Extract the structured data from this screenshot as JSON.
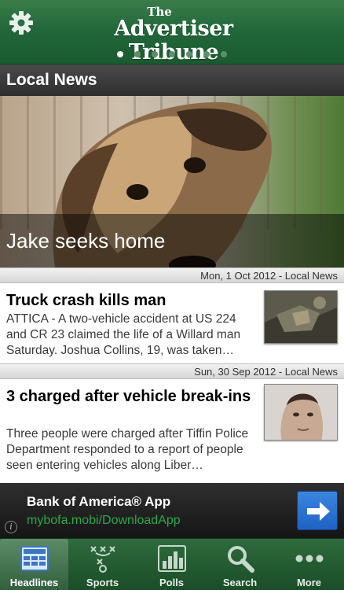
{
  "header": {
    "masthead_the": "The",
    "masthead_name": "Advertiser Tribune",
    "settings_icon": "gear-icon",
    "page_count": 7,
    "active_page": 1
  },
  "section": {
    "title": "Local News"
  },
  "hero": {
    "caption": "Jake seeks home"
  },
  "articles": [
    {
      "date_line": "Mon, 1 Oct 2012 - Local News",
      "title": "Truck crash kills man",
      "summary": "ATTICA - A two-vehicle accident at US 224 and CR 23 claimed the life of a Willard man Saturday. Joshua Collins, 19, was taken…"
    },
    {
      "date_line": "Sun, 30 Sep 2012 - Local News",
      "title": "3 charged after vehicle break-ins",
      "summary": "Three people were charged after Tiffin Police Department responded to a report of people seen entering vehicles along Liber…"
    }
  ],
  "ad": {
    "title": "Bank of America® App",
    "url": "mybofa.mobi/DownloadApp",
    "info_label": "i"
  },
  "tabs": [
    {
      "label": "Headlines",
      "icon": "newspaper-icon"
    },
    {
      "label": "Sports",
      "icon": "playbook-icon"
    },
    {
      "label": "Polls",
      "icon": "bar-chart-icon"
    },
    {
      "label": "Search",
      "icon": "search-icon"
    },
    {
      "label": "More",
      "icon": "more-dots-icon"
    }
  ],
  "colors": {
    "brand_green": "#22683a",
    "ad_url_green": "#2aa84a",
    "ad_button_blue": "#2a74d6"
  }
}
